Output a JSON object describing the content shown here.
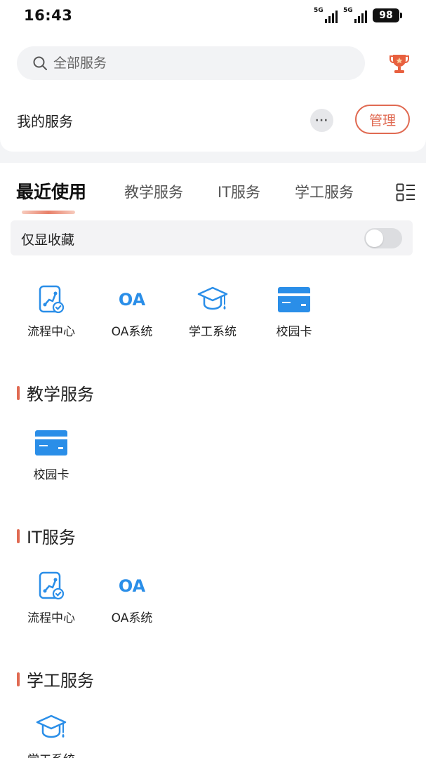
{
  "status_bar": {
    "time": "16:43",
    "signal1": "5G",
    "signal2": "5G",
    "battery": "98"
  },
  "search": {
    "placeholder": "全部服务"
  },
  "my_services": {
    "title": "我的服务",
    "more_label": "···",
    "manage_label": "管理"
  },
  "tabs": [
    {
      "label": "最近使用",
      "active": true
    },
    {
      "label": "教学服务",
      "active": false
    },
    {
      "label": "IT服务",
      "active": false
    },
    {
      "label": "学工服务",
      "active": false
    }
  ],
  "favorites_toggle": {
    "label": "仅显收藏",
    "on": false
  },
  "recent_services": [
    {
      "name": "流程中心",
      "icon": "workflow-icon"
    },
    {
      "name": "OA系统",
      "icon": "oa-logo-icon",
      "icon_text": "OA"
    },
    {
      "name": "学工系统",
      "icon": "graduation-cap-icon"
    },
    {
      "name": "校园卡",
      "icon": "campus-card-icon"
    }
  ],
  "sections": [
    {
      "title": "教学服务",
      "items": [
        {
          "name": "校园卡",
          "icon": "campus-card-icon"
        }
      ]
    },
    {
      "title": "IT服务",
      "items": [
        {
          "name": "流程中心",
          "icon": "workflow-icon"
        },
        {
          "name": "OA系统",
          "icon": "oa-logo-icon",
          "icon_text": "OA"
        }
      ]
    },
    {
      "title": "学工服务",
      "items": [
        {
          "name": "学工系统",
          "icon": "graduation-cap-icon"
        }
      ]
    }
  ],
  "colors": {
    "accent": "#e06a52",
    "icon_blue": "#2a8ee8",
    "background": "#f3f4f6"
  }
}
